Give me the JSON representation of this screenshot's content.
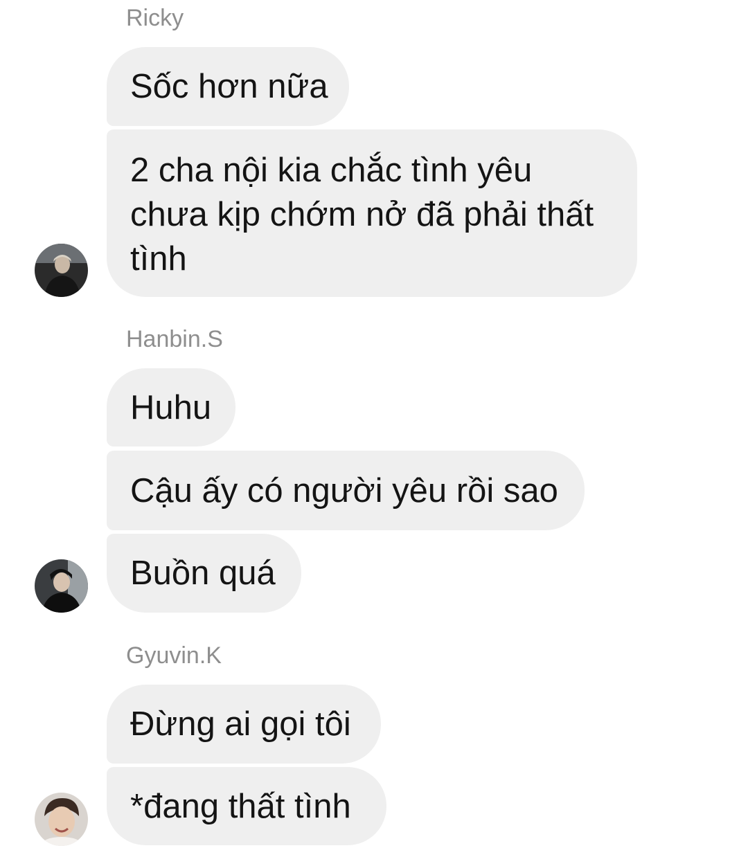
{
  "groups": [
    {
      "sender": "Ricky",
      "avatar_icon": "user-avatar-icon",
      "messages": [
        "Sốc hơn nữa",
        "2 cha nội kia chắc tình yêu chưa kịp chớm nở đã phải thất tình"
      ]
    },
    {
      "sender": "Hanbin.S",
      "avatar_icon": "user-avatar-icon",
      "messages": [
        "Huhu",
        "Cậu ấy có người yêu rồi sao",
        "Buồn quá"
      ]
    },
    {
      "sender": "Gyuvin.K",
      "avatar_icon": "user-avatar-icon",
      "messages": [
        "Đừng ai gọi tôi",
        "*đang thất tình"
      ]
    }
  ],
  "colors": {
    "bubble_bg": "#efefef",
    "sender_text": "#8e8e8e",
    "message_text": "#141414"
  }
}
